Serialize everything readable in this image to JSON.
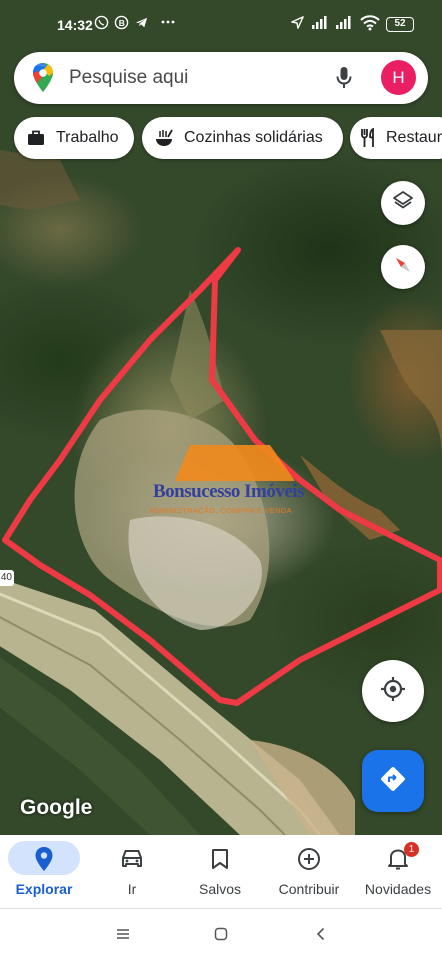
{
  "status_bar": {
    "time": "14:32",
    "battery": "52",
    "icons": [
      "whatsapp-icon",
      "b-icon",
      "telegram-icon",
      "more-dots-icon",
      "location-arrow-icon",
      "signal-icon",
      "signal-icon",
      "wifi-icon",
      "battery-icon"
    ]
  },
  "search": {
    "placeholder": "Pesquise aqui",
    "avatar_initial": "H",
    "avatar_color": "#e91e63"
  },
  "chips": [
    {
      "label": "Trabalho",
      "icon": "briefcase-icon"
    },
    {
      "label": "Cozinhas solidárias",
      "icon": "bowl-icon"
    },
    {
      "label": "Restaurantes",
      "icon": "fork-knife-icon"
    }
  ],
  "map": {
    "attribution": "Google",
    "road_number": "40",
    "boundary_color": "#ee3a44",
    "watermark": {
      "brand": "Bonsucesso Imóveis",
      "tagline": "ADMINISTRAÇÃO, COMPRA E VENDA"
    }
  },
  "map_controls": {
    "layers_icon": "layers-icon",
    "compass_icon": "compass-icon",
    "location_icon": "my-location-icon",
    "directions_icon": "directions-icon",
    "directions_color": "#1a73e8"
  },
  "bottom_nav": [
    {
      "label": "Explorar",
      "icon": "location-pin-icon",
      "active": true
    },
    {
      "label": "Ir",
      "icon": "car-icon",
      "active": false
    },
    {
      "label": "Salvos",
      "icon": "bookmark-icon",
      "active": false
    },
    {
      "label": "Contribuir",
      "icon": "add-circle-icon",
      "active": false
    },
    {
      "label": "Novidades",
      "icon": "bell-icon",
      "active": false,
      "badge": "1"
    }
  ],
  "system_nav": [
    "menu-icon",
    "home-icon",
    "back-icon"
  ]
}
